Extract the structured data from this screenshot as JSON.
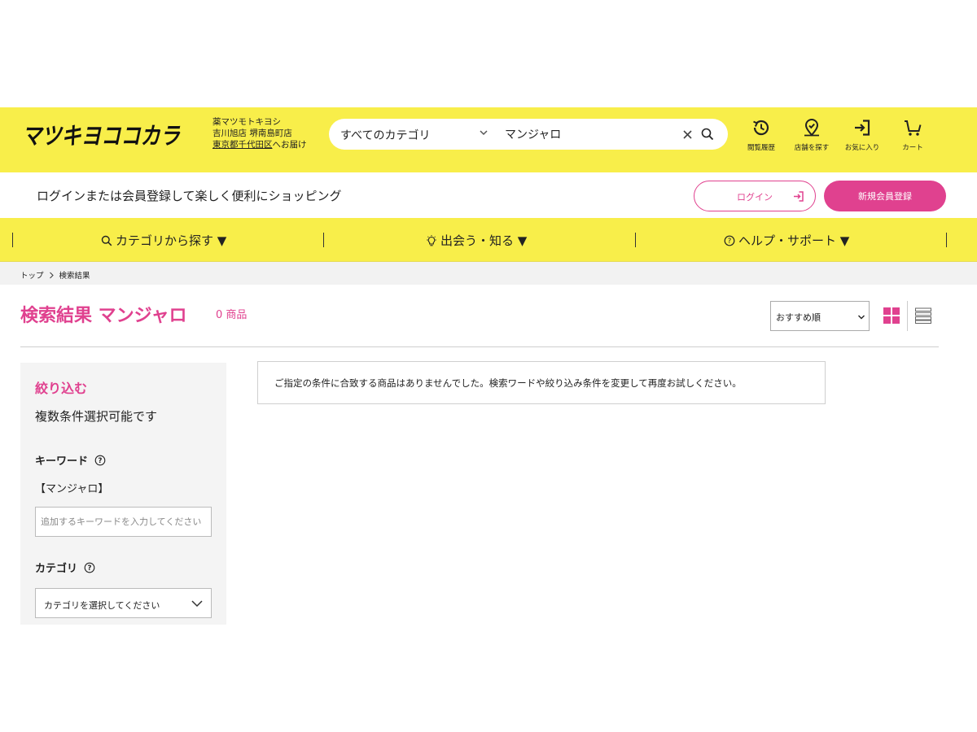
{
  "brand": {
    "logo_text": "マツキヨココカラ",
    "accent": "#e0418f",
    "yellow": "#f8ee4a"
  },
  "store": {
    "line1": "薬マツモトキヨシ",
    "line2": "吉川旭店 堺南島町店",
    "address_link": "東京都千代田区",
    "address_suffix": "へお届け"
  },
  "search": {
    "category": "すべてのカテゴリ",
    "query": "マンジャロ",
    "chevron_icon": "chevron-down-icon",
    "clear_icon": "close-icon",
    "submit_icon": "search-icon"
  },
  "header_icons": [
    {
      "icon": "history-icon",
      "label": "閲覧履歴"
    },
    {
      "icon": "store-pin-icon",
      "label": "店舗を探す"
    },
    {
      "icon": "login-arrow-icon",
      "label": "お気に入り"
    },
    {
      "icon": "cart-icon",
      "label": "カート"
    }
  ],
  "login_bar": {
    "message": "ログインまたは会員登録して楽しく便利にショッピング",
    "login_label": "ログイン",
    "register_label": "新規会員登録"
  },
  "nav": {
    "items": [
      {
        "icon": "search-icon",
        "label": "カテゴリから探す ▼"
      },
      {
        "icon": "lightbulb-icon",
        "label": "出会う・知る ▼"
      },
      {
        "icon": "help-circle-icon",
        "label": "ヘルプ・サポート ▼"
      }
    ]
  },
  "breadcrumb": {
    "home": "トップ",
    "current": "検索結果"
  },
  "results": {
    "title": "検索結果 マンジャロ",
    "count": "0 商品",
    "sort_label": "おすすめ順",
    "empty_message": "ご指定の条件に合致する商品はありませんでした。検索ワードや絞り込み条件を変更して再度お試しください。"
  },
  "filter": {
    "title": "絞り込む",
    "subtitle": "複数条件選択可能です",
    "keyword_heading": "キーワード",
    "keyword_current": "【マンジャロ】",
    "keyword_placeholder": "追加するキーワードを入力してください",
    "category_heading": "カテゴリ",
    "category_select": "カテゴリを選択してください"
  }
}
